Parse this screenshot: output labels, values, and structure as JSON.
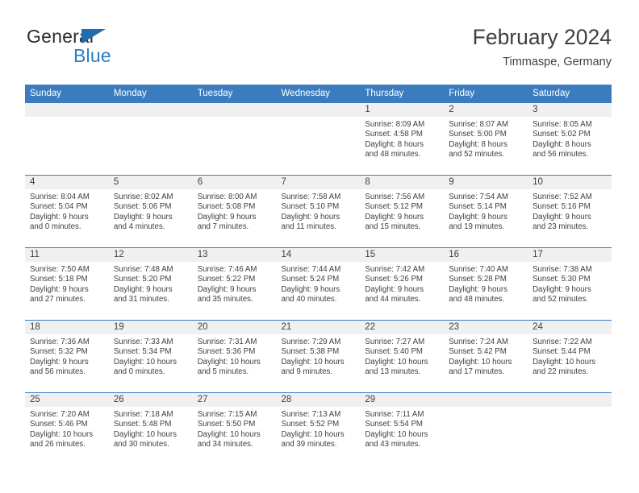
{
  "brand": {
    "logo_text_top": "General",
    "logo_text_bottom": "Blue",
    "logo_triangle_icon": "triangle-icon",
    "accent_color": "#3b7cbe",
    "logo_blue_color": "#2e7bc4",
    "logo_dark_color": "#2b2b2b"
  },
  "header": {
    "title": "February 2024",
    "subtitle": "Timmaspe, Germany"
  },
  "calendar": {
    "weekday_headers": [
      "Sunday",
      "Monday",
      "Tuesday",
      "Wednesday",
      "Thursday",
      "Friday",
      "Saturday"
    ],
    "weeks": [
      [
        {
          "day": "",
          "lines": []
        },
        {
          "day": "",
          "lines": []
        },
        {
          "day": "",
          "lines": []
        },
        {
          "day": "",
          "lines": []
        },
        {
          "day": "1",
          "lines": [
            "Sunrise: 8:09 AM",
            "Sunset: 4:58 PM",
            "Daylight: 8 hours",
            "and 48 minutes."
          ]
        },
        {
          "day": "2",
          "lines": [
            "Sunrise: 8:07 AM",
            "Sunset: 5:00 PM",
            "Daylight: 8 hours",
            "and 52 minutes."
          ]
        },
        {
          "day": "3",
          "lines": [
            "Sunrise: 8:05 AM",
            "Sunset: 5:02 PM",
            "Daylight: 8 hours",
            "and 56 minutes."
          ]
        }
      ],
      [
        {
          "day": "4",
          "lines": [
            "Sunrise: 8:04 AM",
            "Sunset: 5:04 PM",
            "Daylight: 9 hours",
            "and 0 minutes."
          ]
        },
        {
          "day": "5",
          "lines": [
            "Sunrise: 8:02 AM",
            "Sunset: 5:06 PM",
            "Daylight: 9 hours",
            "and 4 minutes."
          ]
        },
        {
          "day": "6",
          "lines": [
            "Sunrise: 8:00 AM",
            "Sunset: 5:08 PM",
            "Daylight: 9 hours",
            "and 7 minutes."
          ]
        },
        {
          "day": "7",
          "lines": [
            "Sunrise: 7:58 AM",
            "Sunset: 5:10 PM",
            "Daylight: 9 hours",
            "and 11 minutes."
          ]
        },
        {
          "day": "8",
          "lines": [
            "Sunrise: 7:56 AM",
            "Sunset: 5:12 PM",
            "Daylight: 9 hours",
            "and 15 minutes."
          ]
        },
        {
          "day": "9",
          "lines": [
            "Sunrise: 7:54 AM",
            "Sunset: 5:14 PM",
            "Daylight: 9 hours",
            "and 19 minutes."
          ]
        },
        {
          "day": "10",
          "lines": [
            "Sunrise: 7:52 AM",
            "Sunset: 5:16 PM",
            "Daylight: 9 hours",
            "and 23 minutes."
          ]
        }
      ],
      [
        {
          "day": "11",
          "lines": [
            "Sunrise: 7:50 AM",
            "Sunset: 5:18 PM",
            "Daylight: 9 hours",
            "and 27 minutes."
          ]
        },
        {
          "day": "12",
          "lines": [
            "Sunrise: 7:48 AM",
            "Sunset: 5:20 PM",
            "Daylight: 9 hours",
            "and 31 minutes."
          ]
        },
        {
          "day": "13",
          "lines": [
            "Sunrise: 7:46 AM",
            "Sunset: 5:22 PM",
            "Daylight: 9 hours",
            "and 35 minutes."
          ]
        },
        {
          "day": "14",
          "lines": [
            "Sunrise: 7:44 AM",
            "Sunset: 5:24 PM",
            "Daylight: 9 hours",
            "and 40 minutes."
          ]
        },
        {
          "day": "15",
          "lines": [
            "Sunrise: 7:42 AM",
            "Sunset: 5:26 PM",
            "Daylight: 9 hours",
            "and 44 minutes."
          ]
        },
        {
          "day": "16",
          "lines": [
            "Sunrise: 7:40 AM",
            "Sunset: 5:28 PM",
            "Daylight: 9 hours",
            "and 48 minutes."
          ]
        },
        {
          "day": "17",
          "lines": [
            "Sunrise: 7:38 AM",
            "Sunset: 5:30 PM",
            "Daylight: 9 hours",
            "and 52 minutes."
          ]
        }
      ],
      [
        {
          "day": "18",
          "lines": [
            "Sunrise: 7:36 AM",
            "Sunset: 5:32 PM",
            "Daylight: 9 hours",
            "and 56 minutes."
          ]
        },
        {
          "day": "19",
          "lines": [
            "Sunrise: 7:33 AM",
            "Sunset: 5:34 PM",
            "Daylight: 10 hours",
            "and 0 minutes."
          ]
        },
        {
          "day": "20",
          "lines": [
            "Sunrise: 7:31 AM",
            "Sunset: 5:36 PM",
            "Daylight: 10 hours",
            "and 5 minutes."
          ]
        },
        {
          "day": "21",
          "lines": [
            "Sunrise: 7:29 AM",
            "Sunset: 5:38 PM",
            "Daylight: 10 hours",
            "and 9 minutes."
          ]
        },
        {
          "day": "22",
          "lines": [
            "Sunrise: 7:27 AM",
            "Sunset: 5:40 PM",
            "Daylight: 10 hours",
            "and 13 minutes."
          ]
        },
        {
          "day": "23",
          "lines": [
            "Sunrise: 7:24 AM",
            "Sunset: 5:42 PM",
            "Daylight: 10 hours",
            "and 17 minutes."
          ]
        },
        {
          "day": "24",
          "lines": [
            "Sunrise: 7:22 AM",
            "Sunset: 5:44 PM",
            "Daylight: 10 hours",
            "and 22 minutes."
          ]
        }
      ],
      [
        {
          "day": "25",
          "lines": [
            "Sunrise: 7:20 AM",
            "Sunset: 5:46 PM",
            "Daylight: 10 hours",
            "and 26 minutes."
          ]
        },
        {
          "day": "26",
          "lines": [
            "Sunrise: 7:18 AM",
            "Sunset: 5:48 PM",
            "Daylight: 10 hours",
            "and 30 minutes."
          ]
        },
        {
          "day": "27",
          "lines": [
            "Sunrise: 7:15 AM",
            "Sunset: 5:50 PM",
            "Daylight: 10 hours",
            "and 34 minutes."
          ]
        },
        {
          "day": "28",
          "lines": [
            "Sunrise: 7:13 AM",
            "Sunset: 5:52 PM",
            "Daylight: 10 hours",
            "and 39 minutes."
          ]
        },
        {
          "day": "29",
          "lines": [
            "Sunrise: 7:11 AM",
            "Sunset: 5:54 PM",
            "Daylight: 10 hours",
            "and 43 minutes."
          ]
        },
        {
          "day": "",
          "lines": []
        },
        {
          "day": "",
          "lines": []
        }
      ]
    ]
  }
}
